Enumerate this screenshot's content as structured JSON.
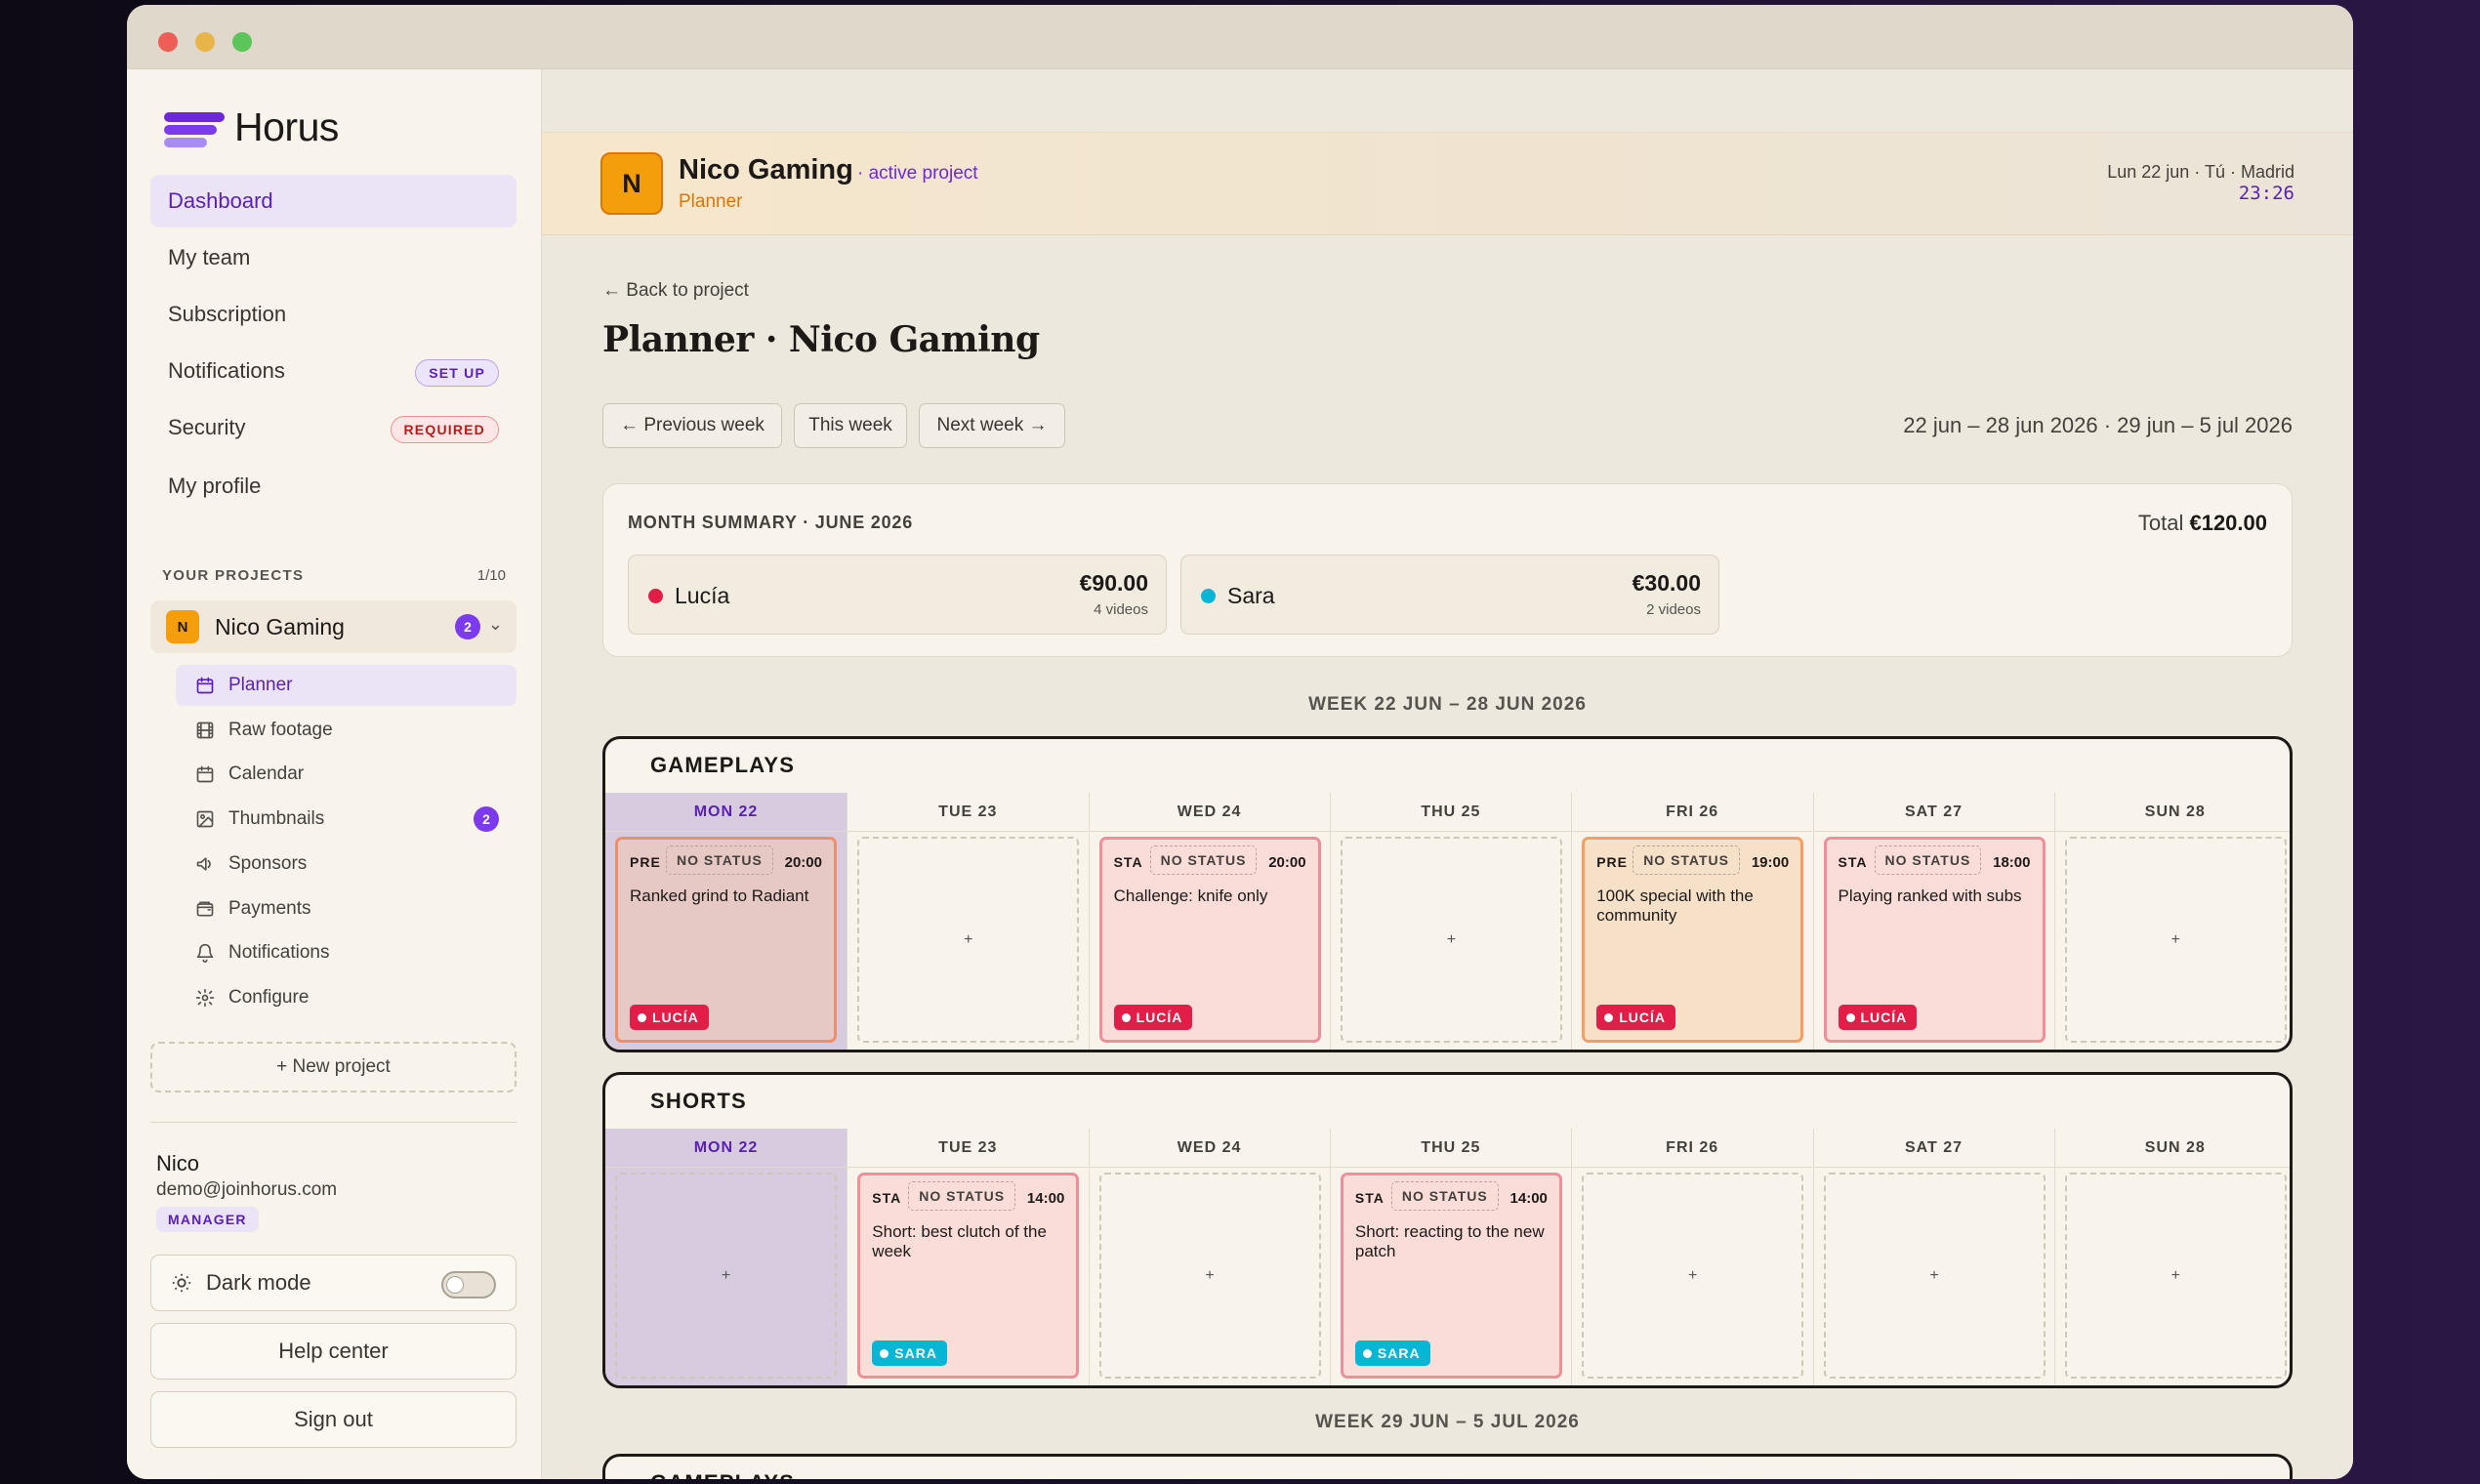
{
  "app": {
    "name": "Horus",
    "brand_color": "#7c3aed",
    "traffic_lights": [
      "#ee5e57",
      "#e8b54a",
      "#5cc55a"
    ]
  },
  "sidebar": {
    "nav": [
      {
        "label": "Dashboard",
        "active": true
      },
      {
        "label": "My team"
      },
      {
        "label": "Subscription"
      },
      {
        "label": "Notifications",
        "badge": "SET UP"
      },
      {
        "label": "Security",
        "badge": "REQUIRED"
      },
      {
        "label": "My profile"
      }
    ],
    "projects_label": "YOUR PROJECTS",
    "projects_count": "1/10",
    "project": {
      "avatar": "N",
      "name": "Nico Gaming",
      "badge": "2"
    },
    "subnav": [
      {
        "label": "Planner",
        "icon": "calendar-icon",
        "active": true
      },
      {
        "label": "Raw footage",
        "icon": "film-icon"
      },
      {
        "label": "Calendar",
        "icon": "calendar-icon"
      },
      {
        "label": "Thumbnails",
        "icon": "image-icon",
        "badge": "2"
      },
      {
        "label": "Sponsors",
        "icon": "megaphone-icon"
      },
      {
        "label": "Payments",
        "icon": "wallet-icon"
      },
      {
        "label": "Notifications",
        "icon": "bell-icon"
      },
      {
        "label": "Configure",
        "icon": "gear-icon"
      }
    ],
    "new_project": "+ New project",
    "user": {
      "name": "Nico",
      "email": "demo@joinhorus.com",
      "role": "MANAGER"
    },
    "dark_mode": {
      "label": "Dark mode",
      "on": false
    },
    "help": "Help center",
    "signout": "Sign out"
  },
  "header": {
    "avatar": "N",
    "project_name": "Nico Gaming",
    "status": "· active project",
    "subtitle": "Planner",
    "date": "Lun 22 jun · Tú · Madrid",
    "time": "23:26"
  },
  "page": {
    "back": "← Back to project",
    "title": "Planner · Nico Gaming",
    "buttons": {
      "prev": "← Previous week",
      "this": "This week",
      "next": "Next week →"
    },
    "range": "22 jun – 28 jun 2026 · 29 jun – 5 jul 2026"
  },
  "summary": {
    "title": "MONTH SUMMARY · JUNE 2026",
    "total_label": "Total",
    "total_value": "€120.00",
    "people": [
      {
        "name": "Lucía",
        "amount": "€90.00",
        "videos": "4 videos",
        "color": "#e11d48"
      },
      {
        "name": "Sara",
        "amount": "€30.00",
        "videos": "2 videos",
        "color": "#06b6d4"
      }
    ]
  },
  "week1": {
    "label": "WEEK 22 JUN – 28 JUN 2026",
    "days": [
      "MON 22",
      "TUE 23",
      "WED 24",
      "THU 25",
      "FRI 26",
      "SAT 27",
      "SUN 28"
    ],
    "sections": [
      {
        "title": "GAMEPLAYS",
        "cells": [
          {
            "tag": "PRE",
            "status": "NO STATUS",
            "time": "20:00",
            "title": "Ranked grind to Radiant",
            "person": "LUCÍA",
            "style": "muted"
          },
          null,
          {
            "tag": "STA",
            "status": "NO STATUS",
            "time": "20:00",
            "title": "Challenge: knife only",
            "person": "LUCÍA",
            "style": "pink"
          },
          null,
          {
            "tag": "PRE",
            "status": "NO STATUS",
            "time": "19:00",
            "title": "100K special with the community",
            "person": "LUCÍA",
            "style": "orange"
          },
          {
            "tag": "STA",
            "status": "NO STATUS",
            "time": "18:00",
            "title": "Playing ranked with subs",
            "person": "LUCÍA",
            "style": "pink"
          },
          null
        ]
      },
      {
        "title": "SHORTS",
        "cells": [
          null,
          {
            "tag": "STA",
            "status": "NO STATUS",
            "time": "14:00",
            "title": "Short: best clutch of the week",
            "person": "SARA",
            "style": "pink"
          },
          null,
          {
            "tag": "STA",
            "status": "NO STATUS",
            "time": "14:00",
            "title": "Short: reacting to the new patch",
            "person": "SARA",
            "style": "pink"
          },
          null,
          null,
          null
        ]
      }
    ],
    "add_symbol": "+"
  },
  "week2": {
    "label": "WEEK 29 JUN – 5 JUL 2026",
    "section_title": "GAMEPLAYS"
  },
  "person_colors": {
    "LUCÍA": "#e11d48",
    "SARA": "#06b6d4"
  }
}
